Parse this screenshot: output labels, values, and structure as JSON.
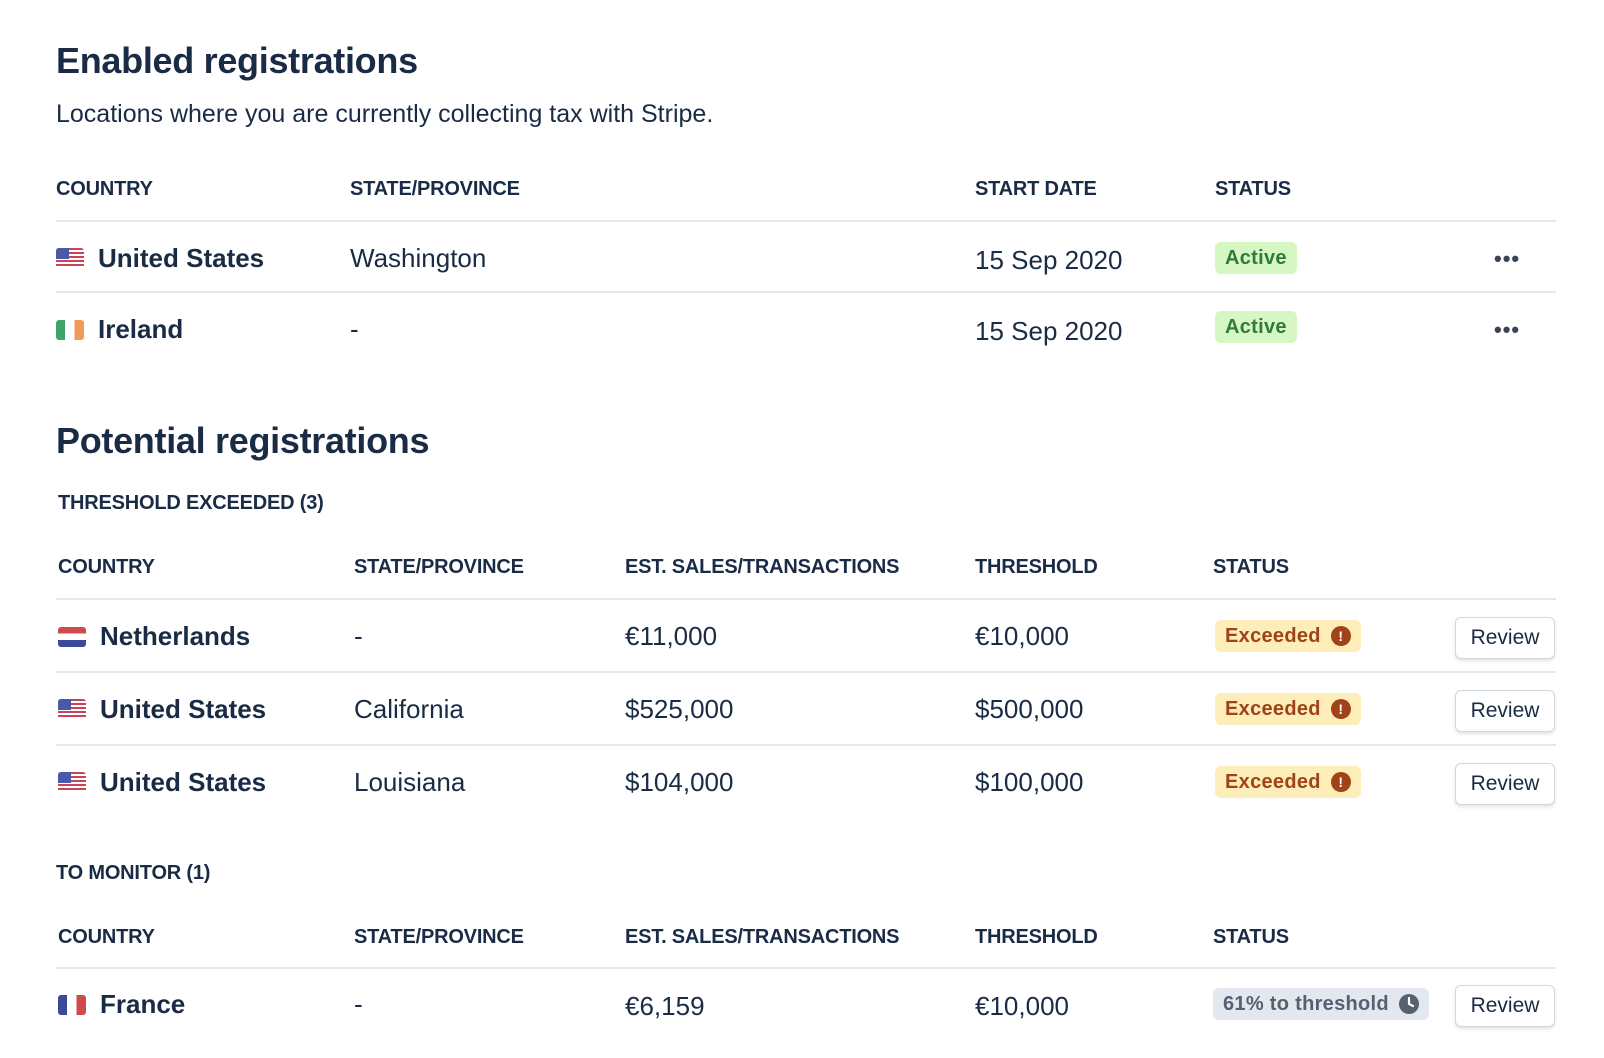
{
  "enabled": {
    "title": "Enabled registrations",
    "subtitle": "Locations where you are currently collecting tax with Stripe.",
    "columns": [
      "COUNTRY",
      "STATE/PROVINCE",
      "START DATE",
      "STATUS"
    ],
    "rows": [
      {
        "country": "United States",
        "flag": "us-flag-icon",
        "state": "Washington",
        "start_date": "15 Sep 2020",
        "status": "Active"
      },
      {
        "country": "Ireland",
        "flag": "ireland-flag-icon",
        "state": "-",
        "start_date": "15 Sep 2020",
        "status": "Active"
      }
    ],
    "more_label": "•••"
  },
  "potential": {
    "title": "Potential registrations",
    "exceeded_section": {
      "label": "THRESHOLD EXCEEDED (3)",
      "columns": [
        "COUNTRY",
        "STATE/PROVINCE",
        "EST. SALES/TRANSACTIONS",
        "THRESHOLD",
        "STATUS"
      ],
      "rows": [
        {
          "country": "Netherlands",
          "flag": "netherlands-flag-icon",
          "state": "-",
          "est_sales": "€11,000",
          "threshold": "€10,000",
          "status": "Exceeded",
          "status_icon": "alert-icon",
          "action": "Review"
        },
        {
          "country": "United States",
          "flag": "us-flag-icon",
          "state": "California",
          "est_sales": "$525,000",
          "threshold": "$500,000",
          "status": "Exceeded",
          "status_icon": "alert-icon",
          "action": "Review"
        },
        {
          "country": "United States",
          "flag": "us-flag-icon",
          "state": "Louisiana",
          "est_sales": "$104,000",
          "threshold": "$100,000",
          "status": "Exceeded",
          "status_icon": "alert-icon",
          "action": "Review"
        }
      ]
    },
    "monitor_section": {
      "label": "TO MONITOR (1)",
      "columns": [
        "COUNTRY",
        "STATE/PROVINCE",
        "EST. SALES/TRANSACTIONS",
        "THRESHOLD",
        "STATUS"
      ],
      "rows": [
        {
          "country": "France",
          "flag": "france-flag-icon",
          "state": "-",
          "est_sales": "€6,159",
          "threshold": "€10,000",
          "status": "61% to threshold",
          "status_icon": "clock-icon",
          "action": "Review"
        }
      ]
    }
  },
  "colors": {
    "text": "#1a2b45",
    "divider": "#e3e8ee",
    "active_bg": "#d7f7c2",
    "active_text": "#2f7a3e",
    "exceeded_bg": "#fcedb9",
    "exceeded_text": "#a04318",
    "monitor_bg": "#e3e8ee",
    "monitor_text": "#556070"
  }
}
